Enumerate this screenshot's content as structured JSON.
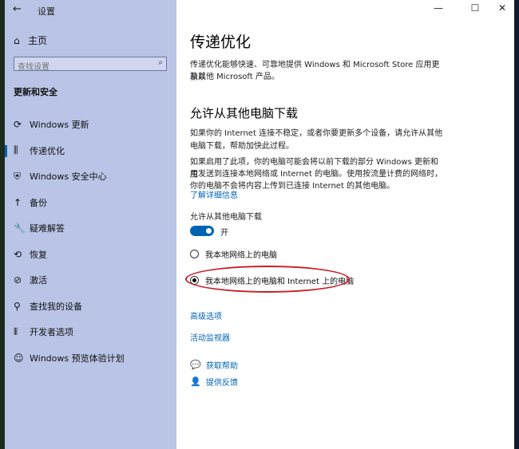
{
  "window": {
    "title": "设置",
    "back_glyph": "←",
    "controls": {
      "minimize": "—",
      "maximize": "☐",
      "close": "✕"
    }
  },
  "sidebar": {
    "home_icon": "⌂",
    "home_label": "主页",
    "search": {
      "placeholder": "查找设置",
      "icon": "⌕"
    },
    "section_title": "更新和安全",
    "items": [
      {
        "label": "Windows 更新",
        "icon": "⟳",
        "active": false
      },
      {
        "label": "传递优化",
        "icon": "⫼",
        "active": true
      },
      {
        "label": "Windows 安全中心",
        "icon": "⛨",
        "active": false
      },
      {
        "label": "备份",
        "icon": "↑",
        "active": false
      },
      {
        "label": "疑难解答",
        "icon": "🔧",
        "active": false
      },
      {
        "label": "恢复",
        "icon": "⟲",
        "active": false
      },
      {
        "label": "激活",
        "icon": "⊘",
        "active": false
      },
      {
        "label": "查找我的设备",
        "icon": "⚲",
        "active": false
      },
      {
        "label": "开发者选项",
        "icon": "⫴",
        "active": false
      },
      {
        "label": "Windows 预览体验计划",
        "icon": "☺",
        "active": false
      }
    ]
  },
  "main": {
    "title": "传递优化",
    "intro_1": "传递优化能够快速、可靠地提供 Windows 和 Microsoft Store 应用更新以",
    "intro_2": "及其他 Microsoft 产品。",
    "allow_title": "允许从其他电脑下载",
    "p1_1": "如果你的 Internet 连接不稳定，或者你要更新多个设备，请允许从其他",
    "p1_2": "电脑下载，帮助加快此过程。",
    "p2_1": "如果启用了此项，你的电脑可能会将以前下载的部分 Windows 更新和应",
    "p2_2": "用发送到连接本地网络或 Internet 的电脑。使用按流量计费的网络时，",
    "p2_3": "你的电脑不会将内容上传到已连接 Internet 的其他电脑。",
    "learn_more": "了解详细信息",
    "toggle_label": "允许从其他电脑下载",
    "toggle_state": "开",
    "toggle_on": true,
    "radio_local": "我本地网络上的电脑",
    "radio_internet": "我本地网络上的电脑和 Internet 上的电脑",
    "selected_option": "radio_internet",
    "advanced_options": "高级选项",
    "activity_monitor": "活动监视器",
    "get_help": "获取帮助",
    "get_help_icon": "💬",
    "feedback": "提供反馈",
    "feedback_icon": "👤"
  },
  "colors": {
    "accent": "#0063b1",
    "sidebar_bg": "#b9c4e6",
    "annotation": "#c81e2a"
  }
}
